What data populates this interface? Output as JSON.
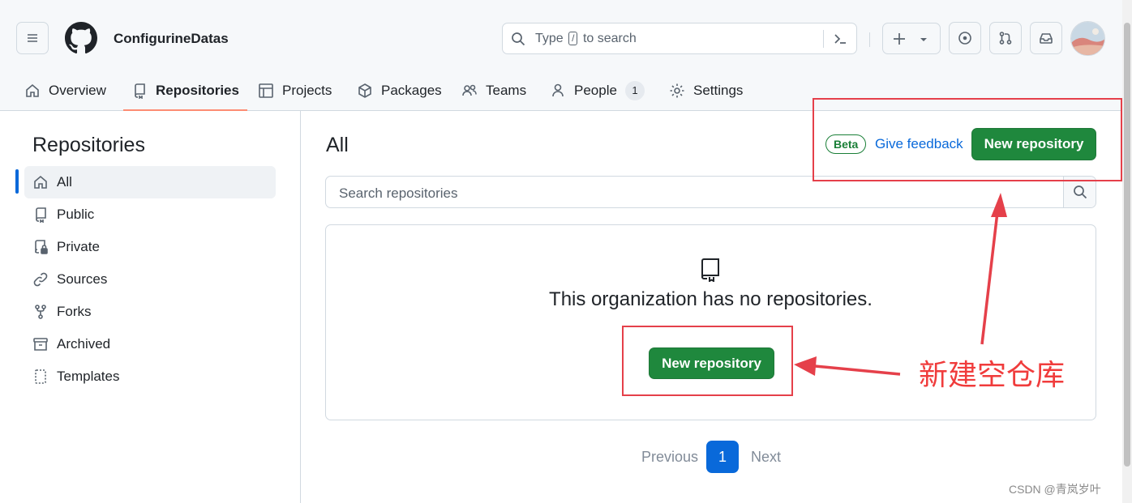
{
  "header": {
    "org_name": "ConfigurineDatas",
    "search_prefix": "Type",
    "search_key": "/",
    "search_suffix": "to search"
  },
  "nav": {
    "tabs": [
      {
        "label": "Overview"
      },
      {
        "label": "Repositories"
      },
      {
        "label": "Projects"
      },
      {
        "label": "Packages"
      },
      {
        "label": "Teams"
      },
      {
        "label": "People"
      },
      {
        "label": "Settings"
      }
    ],
    "people_count": "1"
  },
  "sidebar": {
    "title": "Repositories",
    "items": [
      {
        "label": "All"
      },
      {
        "label": "Public"
      },
      {
        "label": "Private"
      },
      {
        "label": "Sources"
      },
      {
        "label": "Forks"
      },
      {
        "label": "Archived"
      },
      {
        "label": "Templates"
      }
    ]
  },
  "main": {
    "title": "All",
    "beta_label": "Beta",
    "feedback_label": "Give feedback",
    "new_repo_label": "New repository",
    "search_placeholder": "Search repositories",
    "empty_message": "This organization has no repositories.",
    "empty_button_label": "New repository"
  },
  "pagination": {
    "previous": "Previous",
    "current": "1",
    "next": "Next"
  },
  "annotation": {
    "text": "新建空仓库"
  },
  "watermark": "CSDN @青岚岁叶",
  "colors": {
    "accent_blue": "#0969da",
    "green_button": "#1f883d",
    "annotation_red": "#e5404a"
  }
}
